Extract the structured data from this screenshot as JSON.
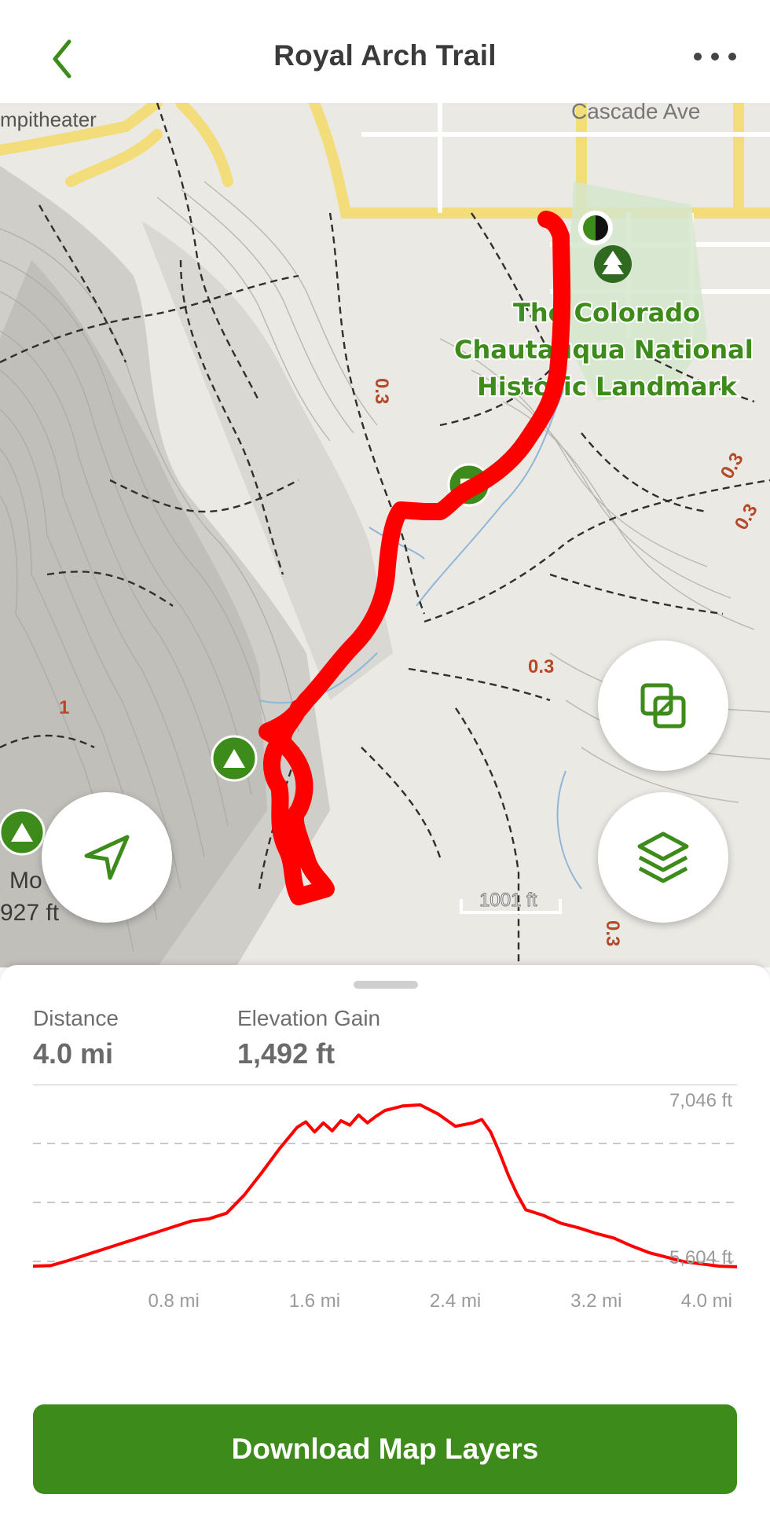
{
  "header": {
    "title": "Royal Arch Trail",
    "back_icon": "chevron-left-icon",
    "more_icon": "more-horizontal-icon"
  },
  "map": {
    "labels": {
      "street": "Cascade Ave",
      "amphitheater": "mpitheater",
      "landmark_line1": "The Colorado",
      "landmark_line2": "Chautauqua National",
      "landmark_line3": "Historic Landmark",
      "peak_name": "Mo",
      "peak_elev": "927 ft",
      "scale": "1001 ft",
      "dist_a": "0.3",
      "dist_b": "0.3",
      "dist_c": "0.3",
      "dist_d": "0.3",
      "dist_e": "0.3",
      "dist_f": "1"
    },
    "colors": {
      "trail": "#ff0000",
      "road": "#f3dc7a",
      "park": "#d5e6cc",
      "accent": "#3d8b1a"
    }
  },
  "stats": {
    "distance_label": "Distance",
    "distance_value": "4.0 mi",
    "elevation_label": "Elevation Gain",
    "elevation_value": "1,492 ft"
  },
  "chart_data": {
    "type": "line",
    "title": "",
    "xlabel": "",
    "ylabel": "",
    "xlim": [
      0,
      4.0
    ],
    "ylim": [
      5604,
      7046
    ],
    "x_ticks": [
      "0.8 mi",
      "1.6 mi",
      "2.4 mi",
      "3.2 mi",
      "4.0 mi"
    ],
    "y_ticks": [
      "7,046 ft",
      "5,604 ft"
    ],
    "grid": "horizontal dashed",
    "color": "#ff0000",
    "series": [
      {
        "x": [
          0.0,
          0.1,
          0.2,
          0.3,
          0.4,
          0.5,
          0.6,
          0.7,
          0.8,
          0.9,
          1.0,
          1.1,
          1.2,
          1.3,
          1.4,
          1.5,
          1.55,
          1.6,
          1.65,
          1.7,
          1.75,
          1.8,
          1.85,
          1.9,
          1.95,
          2.0,
          2.05,
          2.1,
          2.2,
          2.3,
          2.4,
          2.5,
          2.55,
          2.6,
          2.65,
          2.7,
          2.75,
          2.8,
          2.9,
          3.0,
          3.1,
          3.2,
          3.3,
          3.4,
          3.5,
          3.6,
          3.7,
          3.8,
          3.9,
          4.0
        ],
        "y": [
          5610,
          5615,
          5660,
          5710,
          5760,
          5810,
          5860,
          5910,
          5960,
          6010,
          6030,
          6080,
          6240,
          6440,
          6650,
          6840,
          6890,
          6800,
          6880,
          6810,
          6900,
          6860,
          6950,
          6880,
          6940,
          6990,
          7010,
          7030,
          7040,
          6960,
          6850,
          6880,
          6910,
          6800,
          6620,
          6420,
          6250,
          6110,
          6060,
          5990,
          5950,
          5900,
          5860,
          5790,
          5730,
          5690,
          5650,
          5630,
          5610,
          5605
        ]
      }
    ]
  },
  "buttons": {
    "download_label": "Download Map Layers",
    "locate_icon": "navigation-arrow-icon",
    "overlay_icon": "overlay-squares-icon",
    "layers_icon": "layers-icon"
  }
}
